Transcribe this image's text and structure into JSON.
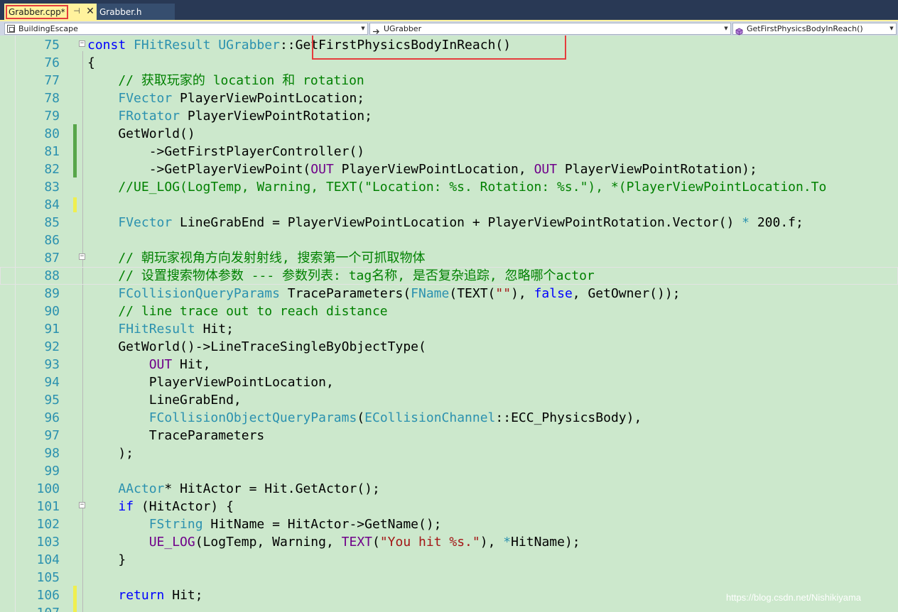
{
  "tabs": [
    {
      "label": "Grabber.cpp*",
      "active": true,
      "pin_glyph": "⊣",
      "close_glyph": "✕"
    },
    {
      "label": "Grabber.h",
      "active": false
    }
  ],
  "navbar": {
    "project": "BuildingEscape",
    "class": "UGrabber",
    "member": "GetFirstPhysicsBodyInReach()"
  },
  "colors": {
    "tab_active_bg": "#fff29d",
    "highlight_box": "#e53d3d",
    "editor_bg": "#cce8cc",
    "line_number": "#2b91af",
    "keyword": "#0000ff",
    "type": "#2b91af",
    "comment": "#008000",
    "string": "#a31515",
    "macro": "#6f008a"
  },
  "icons": {
    "project_icon": "project-icon",
    "class_icon": "class-arrow-icon",
    "member_icon": "method-cube-icon"
  },
  "code": {
    "lines": [
      {
        "no": "75",
        "tokens": [
          [
            "kw",
            "const "
          ],
          [
            "ty",
            "FHitResult "
          ],
          [
            "ty",
            "UGrabber"
          ],
          [
            "op",
            "::"
          ],
          [
            "op",
            "GetFirstPhysicsBodyInReach()"
          ]
        ]
      },
      {
        "no": "76",
        "tokens": [
          [
            "op",
            "{"
          ]
        ]
      },
      {
        "no": "77",
        "tokens": [
          [
            "cm",
            "    // 获取玩家的 location 和 rotation"
          ]
        ]
      },
      {
        "no": "78",
        "tokens": [
          [
            "op",
            "    "
          ],
          [
            "ty",
            "FVector"
          ],
          [
            "op",
            " PlayerViewPointLocation;"
          ]
        ]
      },
      {
        "no": "79",
        "tokens": [
          [
            "op",
            "    "
          ],
          [
            "ty",
            "FRotator"
          ],
          [
            "op",
            " PlayerViewPointRotation;"
          ]
        ]
      },
      {
        "no": "80",
        "tokens": [
          [
            "op",
            "    GetWorld()"
          ]
        ]
      },
      {
        "no": "81",
        "tokens": [
          [
            "op",
            "        ->GetFirstPlayerController()"
          ]
        ]
      },
      {
        "no": "82",
        "tokens": [
          [
            "op",
            "        ->GetPlayerViewPoint("
          ],
          [
            "mc",
            "OUT"
          ],
          [
            "op",
            " PlayerViewPointLocation, "
          ],
          [
            "mc",
            "OUT"
          ],
          [
            "op",
            " PlayerViewPointRotation);"
          ]
        ]
      },
      {
        "no": "83",
        "tokens": [
          [
            "cm",
            "    //UE_LOG(LogTemp, Warning, TEXT(\"Location: %s. Rotation: %s.\"), *(PlayerViewPointLocation.To"
          ]
        ]
      },
      {
        "no": "84",
        "tokens": []
      },
      {
        "no": "85",
        "tokens": [
          [
            "op",
            "    "
          ],
          [
            "ty",
            "FVector"
          ],
          [
            "op",
            " LineGrabEnd = PlayerViewPointLocation + PlayerViewPointRotation.Vector() "
          ],
          [
            "ty",
            "*"
          ],
          [
            "op",
            " 200.f;"
          ]
        ]
      },
      {
        "no": "86",
        "tokens": []
      },
      {
        "no": "87",
        "tokens": [
          [
            "cm",
            "    // 朝玩家视角方向发射射线, 搜索第一个可抓取物体"
          ]
        ]
      },
      {
        "no": "88",
        "tokens": [
          [
            "cm",
            "    // 设置搜索物体参数 --- 参数列表: tag名称, 是否复杂追踪, 忽略哪个actor"
          ]
        ]
      },
      {
        "no": "89",
        "tokens": [
          [
            "op",
            "    "
          ],
          [
            "ty",
            "FCollisionQueryParams"
          ],
          [
            "op",
            " TraceParameters("
          ],
          [
            "ty",
            "FName"
          ],
          [
            "op",
            "(TEXT("
          ],
          [
            "st",
            "\"\""
          ],
          [
            "op",
            "), "
          ],
          [
            "kw",
            "false"
          ],
          [
            "op",
            ", GetOwner());"
          ]
        ]
      },
      {
        "no": "90",
        "tokens": [
          [
            "cm",
            "    // line trace out to reach distance"
          ]
        ]
      },
      {
        "no": "91",
        "tokens": [
          [
            "op",
            "    "
          ],
          [
            "ty",
            "FHitResult"
          ],
          [
            "op",
            " Hit;"
          ]
        ]
      },
      {
        "no": "92",
        "tokens": [
          [
            "op",
            "    GetWorld()->LineTraceSingleByObjectType("
          ]
        ]
      },
      {
        "no": "93",
        "tokens": [
          [
            "op",
            "        "
          ],
          [
            "mc",
            "OUT"
          ],
          [
            "op",
            " Hit,"
          ]
        ]
      },
      {
        "no": "94",
        "tokens": [
          [
            "op",
            "        PlayerViewPointLocation,"
          ]
        ]
      },
      {
        "no": "95",
        "tokens": [
          [
            "op",
            "        LineGrabEnd,"
          ]
        ]
      },
      {
        "no": "96",
        "tokens": [
          [
            "op",
            "        "
          ],
          [
            "ty",
            "FCollisionObjectQueryParams"
          ],
          [
            "op",
            "("
          ],
          [
            "ty",
            "ECollisionChannel"
          ],
          [
            "op",
            "::ECC_PhysicsBody),"
          ]
        ]
      },
      {
        "no": "97",
        "tokens": [
          [
            "op",
            "        TraceParameters"
          ]
        ]
      },
      {
        "no": "98",
        "tokens": [
          [
            "op",
            "    );"
          ]
        ]
      },
      {
        "no": "99",
        "tokens": []
      },
      {
        "no": "100",
        "tokens": [
          [
            "op",
            "    "
          ],
          [
            "ty",
            "AActor"
          ],
          [
            "op",
            "* HitActor = Hit.GetActor();"
          ]
        ]
      },
      {
        "no": "101",
        "tokens": [
          [
            "op",
            "    "
          ],
          [
            "kw",
            "if"
          ],
          [
            "op",
            " (HitActor) {"
          ]
        ]
      },
      {
        "no": "102",
        "tokens": [
          [
            "op",
            "        "
          ],
          [
            "ty",
            "FString"
          ],
          [
            "op",
            " HitName = HitActor->GetName();"
          ]
        ]
      },
      {
        "no": "103",
        "tokens": [
          [
            "op",
            "        "
          ],
          [
            "mc",
            "UE_LOG"
          ],
          [
            "op",
            "(LogTemp, Warning, "
          ],
          [
            "mc",
            "TEXT"
          ],
          [
            "op",
            "("
          ],
          [
            "st",
            "\"You hit %s.\""
          ],
          [
            "op",
            "), "
          ],
          [
            "ty",
            "*"
          ],
          [
            "op",
            "HitName);"
          ]
        ]
      },
      {
        "no": "104",
        "tokens": [
          [
            "op",
            "    }"
          ]
        ]
      },
      {
        "no": "105",
        "tokens": []
      },
      {
        "no": "106",
        "tokens": [
          [
            "op",
            "    "
          ],
          [
            "kw",
            "return"
          ],
          [
            "op",
            " Hit;"
          ]
        ]
      },
      {
        "no": "107",
        "tokens": []
      }
    ]
  },
  "watermark": "https://blog.csdn.net/Nishikiyama"
}
